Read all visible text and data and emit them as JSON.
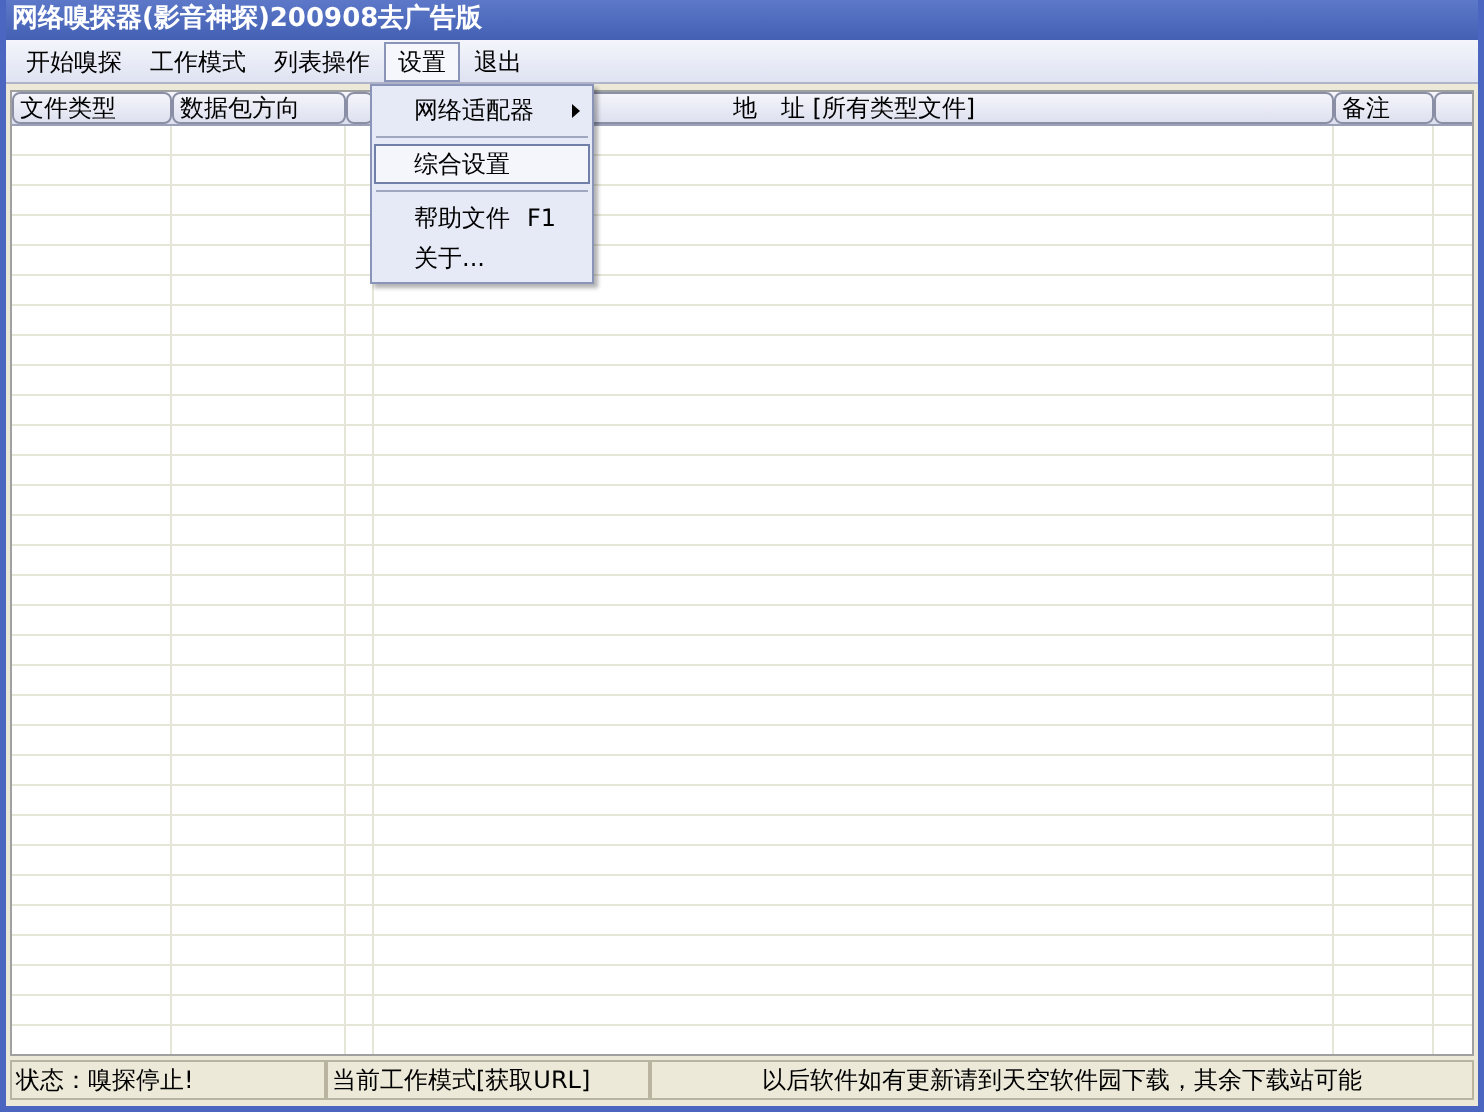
{
  "window": {
    "title": "网络嗅探器(影音神探)200908去广告版"
  },
  "menu_bar": [
    {
      "label": "开始嗅探",
      "selected": false
    },
    {
      "label": "工作模式",
      "selected": false
    },
    {
      "label": "列表操作",
      "selected": false
    },
    {
      "label": "设置",
      "selected": true
    },
    {
      "label": "退出",
      "selected": false
    }
  ],
  "dropdown_menu": [
    {
      "kind": "submenu",
      "label": "网络适配器",
      "selected": false
    },
    {
      "kind": "separator"
    },
    {
      "kind": "item",
      "label": "综合设置",
      "selected": true
    },
    {
      "kind": "separator"
    },
    {
      "kind": "item",
      "label": "帮助文件",
      "shortcut": "F1",
      "selected": false
    },
    {
      "kind": "item",
      "label": "关于...",
      "selected": false
    }
  ],
  "table": {
    "columns": [
      "文件类型",
      "数据包方向",
      "",
      "地　址 [所有类型文件]",
      "备注",
      ""
    ]
  },
  "status_bar": [
    "状态：嗅探停止!",
    "当前工作模式[获取URL]",
    "以后软件如有更新请到天空软件园下载，其余下载站可能"
  ]
}
